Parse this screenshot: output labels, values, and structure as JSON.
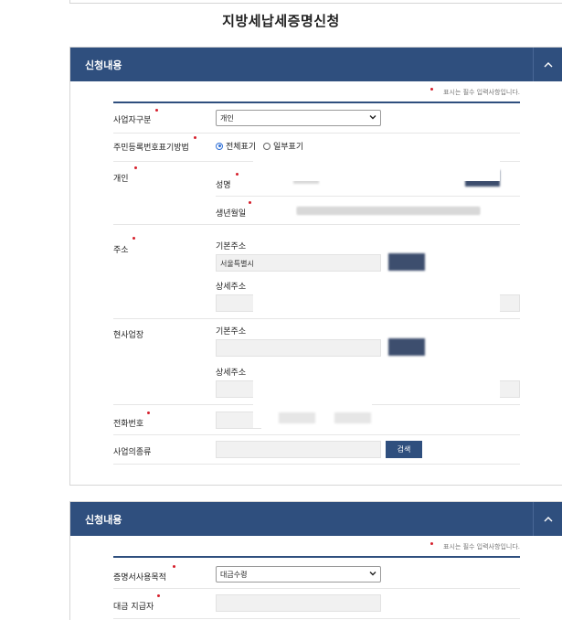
{
  "page": {
    "title": "지방세납세증명신청"
  },
  "section1": {
    "header": "신청내용",
    "required_note": "표시는 필수 입력사항입니다.",
    "business_type": {
      "label": "사업자구분",
      "selected": "개인"
    },
    "rrn_display": {
      "label": "주민등록번호표기방법",
      "option_full": "전체표기",
      "option_partial": "일부표기"
    },
    "individual": {
      "label": "개인",
      "name_label": "성명",
      "birth_label": "생년월일"
    },
    "address": {
      "label": "주소",
      "basic_label": "기본주소",
      "basic_value": "서울특별시",
      "detail_label": "상세주소"
    },
    "workplace": {
      "label": "현사업장",
      "basic_label": "기본주소",
      "detail_label": "상세주소"
    },
    "phone": {
      "label": "전화번호"
    },
    "business_kind": {
      "label": "사업의종류",
      "search_button": "검색"
    }
  },
  "section2": {
    "header": "신청내용",
    "required_note": "표시는 필수 입력사항입니다.",
    "purpose": {
      "label": "증명서사용목적",
      "selected": "대금수령"
    },
    "payer": {
      "label": "대금 지급자"
    }
  },
  "colors": {
    "header_bg": "#2f4f7e",
    "required_dot": "#d6202c",
    "radio_accent": "#2f6fd6"
  },
  "icons": {
    "collapse": "chevron-up-icon",
    "select": "chevron-down-icon"
  }
}
